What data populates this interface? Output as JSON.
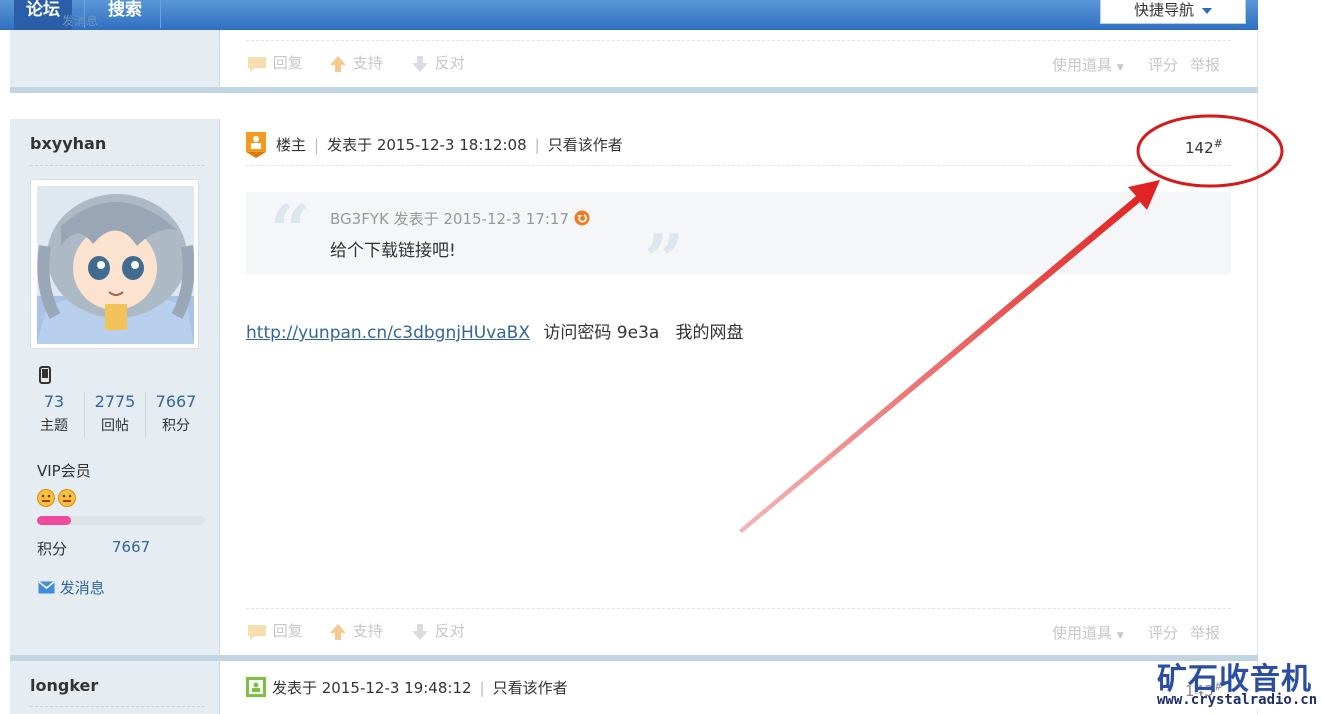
{
  "nav": {
    "forum": "论坛",
    "search": "搜索",
    "ghost_msg": "发消息",
    "quick_nav": "快捷导航"
  },
  "actions": {
    "reply": "回复",
    "support": "支持",
    "oppose": "反对",
    "use_tool": "使用道具",
    "rate": "评分",
    "report": "举报"
  },
  "post142": {
    "username": "bxyyhan",
    "stats": [
      {
        "value": "73",
        "label": "主题"
      },
      {
        "value": "2775",
        "label": "回帖"
      },
      {
        "value": "7667",
        "label": "积分"
      }
    ],
    "group": "VIP会员",
    "points_label": "积分",
    "points_value": "7667",
    "points_progress": 0.2,
    "send_msg": "发消息",
    "role": "楼主",
    "posted_at": "发表于 2015-12-3 18:12:08",
    "only_author": "只看该作者",
    "floor": "142",
    "floor_sup": "#",
    "quote_author": "BG3FYK 发表于 2015-12-3 17:17",
    "quote_text": "给个下载链接吧!",
    "link": "http://yunpan.cn/c3dbgnjHUvaBX",
    "body_rest": "访问密码 9e3a   我的网盘"
  },
  "post143": {
    "username": "longker",
    "posted_at": "发表于 2015-12-3 19:48:12",
    "only_author": "只看该作者",
    "floor": "143",
    "floor_sup": "#"
  },
  "watermark": {
    "title": "矿石收音机",
    "url": "www.crystalradio.cn"
  },
  "colors": {
    "nav_blue": "#3b7ccb",
    "link_blue": "#336699",
    "annotation_red": "#e01e1e",
    "progress_pink": "#f04a9c"
  }
}
